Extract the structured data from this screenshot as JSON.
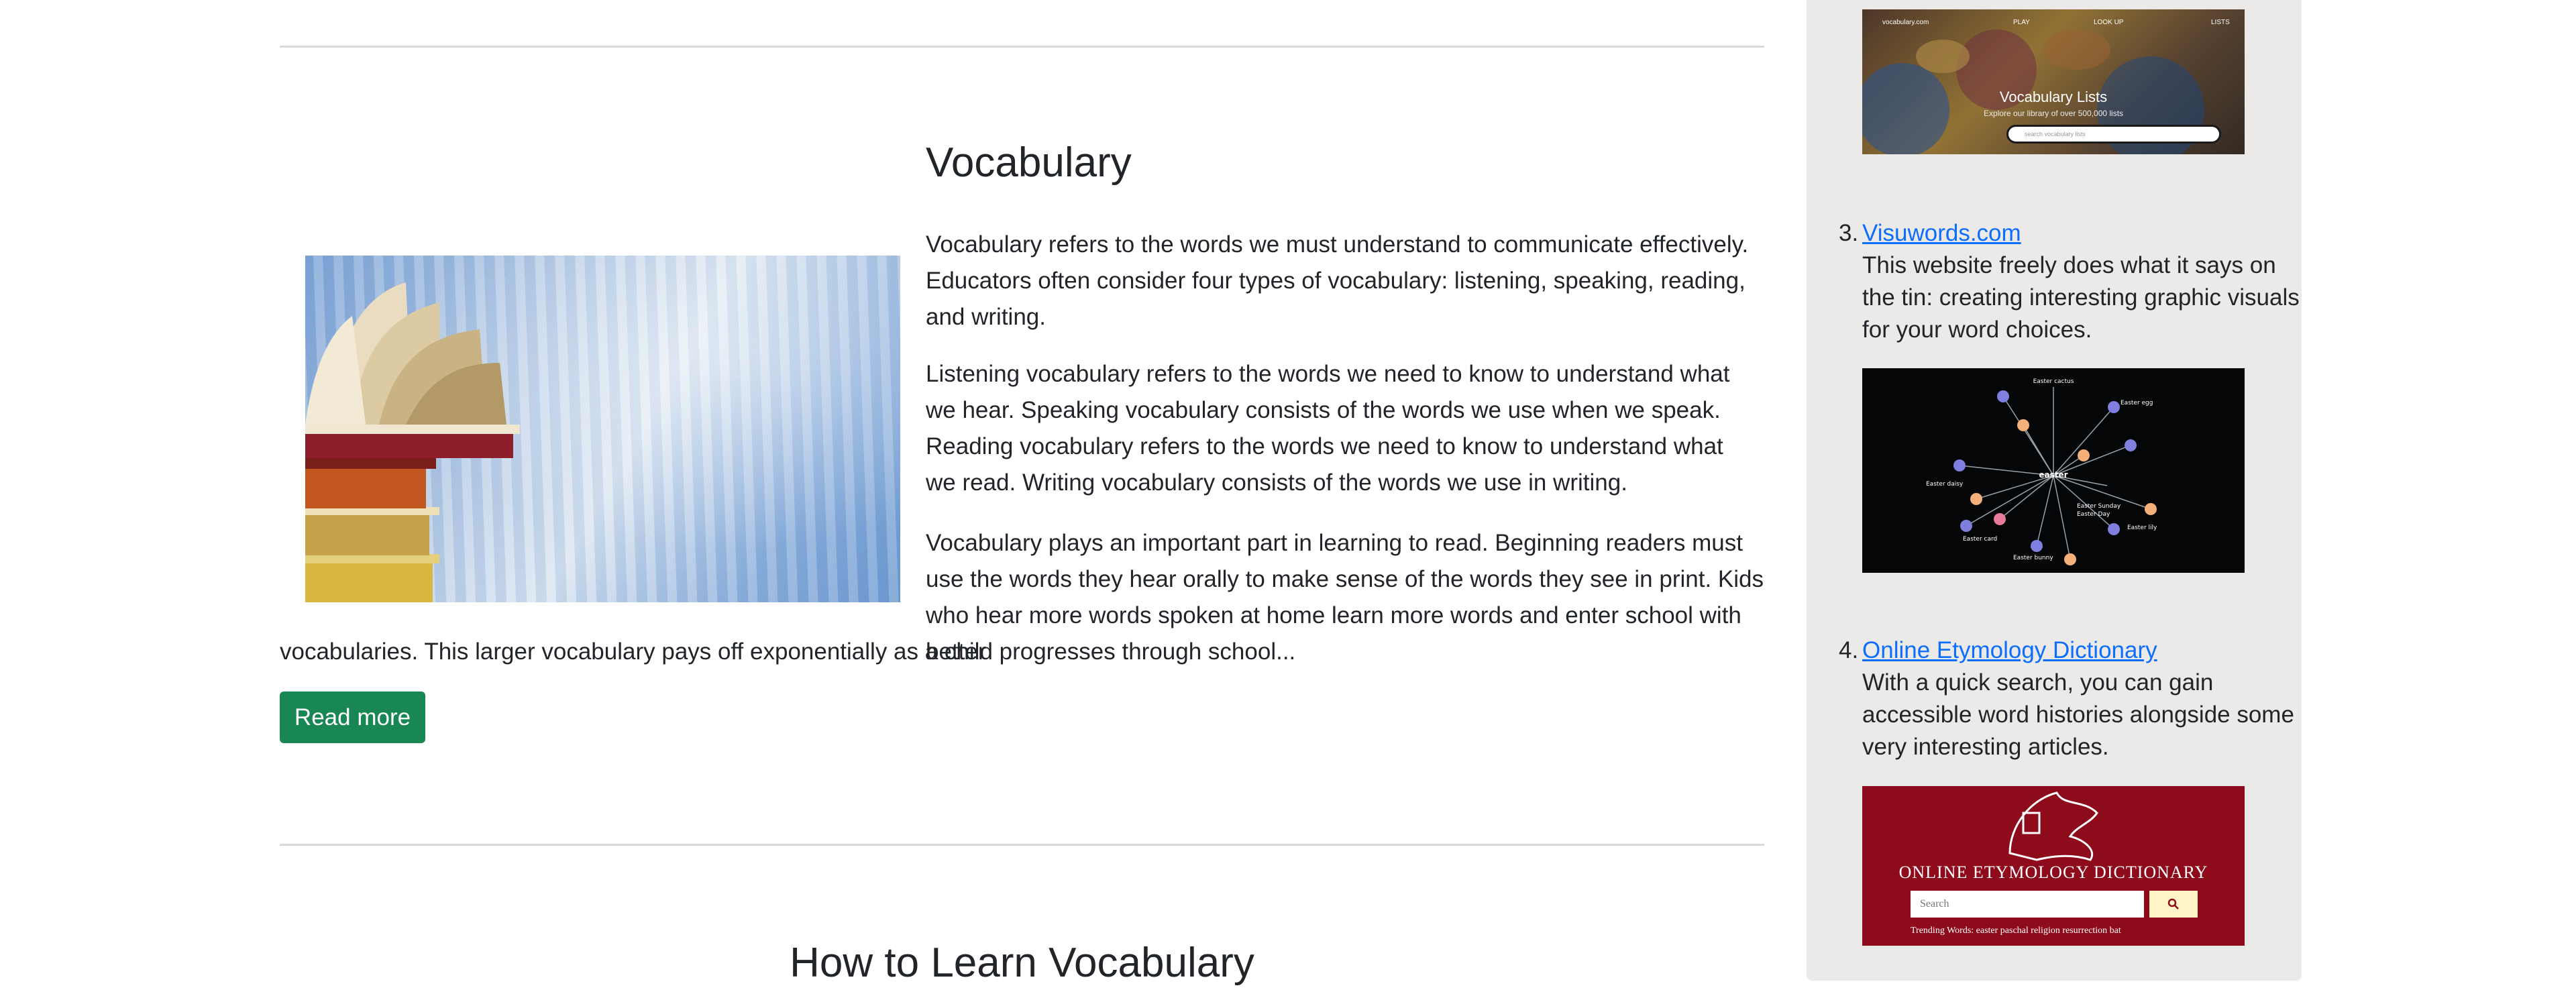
{
  "article": {
    "title": "Vocabulary",
    "paragraphs": [
      "Vocabulary refers to the words we must understand to communicate effectively. Educators often consider four types of vocabulary: listening, speaking, reading, and writing.",
      "Listening vocabulary refers to the words we need to know to understand what we hear. Speaking vocabulary consists of the words we use when we speak. Reading vocabulary refers to the words we need to know to understand what we read. Writing vocabulary consists of the words we use in writing.",
      "Vocabulary plays an important part in learning to read. Beginning readers must use the words they hear orally to make sense of the words they see in print. Kids who hear more words spoken at home learn more words and enter school with better",
      "vocabularies. This larger vocabulary pays off exponentially as a child progresses through school..."
    ],
    "read_more_label": "Read more"
  },
  "next_article": {
    "title": "How to Learn Vocabulary"
  },
  "sidebar": {
    "thumb1": {
      "brand": "vocabulary.com",
      "nav": [
        "PLAY",
        "LOOK UP",
        "LISTS"
      ],
      "title": "Vocabulary Lists",
      "subtitle": "Explore our library of over 500,000 lists",
      "search_placeholder": "search vocabulary lists"
    },
    "items": [
      {
        "number": "3.",
        "link": "Visuwords.com",
        "description": "This website freely does what it says on the tin: creating interesting graphic visuals for your word choices."
      },
      {
        "number": "4.",
        "link": "Online Etymology Dictionary",
        "description": "With a quick search, you can gain accessible word histories alongside some very interesting articles."
      }
    ],
    "thumb2": {
      "center": "easter",
      "nodes": [
        "Easter cactus",
        "Easter egg",
        "Easter lily",
        "Easter daisy",
        "Easter card",
        "Easter bunny",
        "Easter Sunday",
        "Easter Day"
      ]
    },
    "thumb3": {
      "title": "ONLINE ETYMOLOGY DICTIONARY",
      "search_placeholder": "Search",
      "trending": "Trending Words:   easter   paschal   religion   resurrection   bat"
    }
  }
}
